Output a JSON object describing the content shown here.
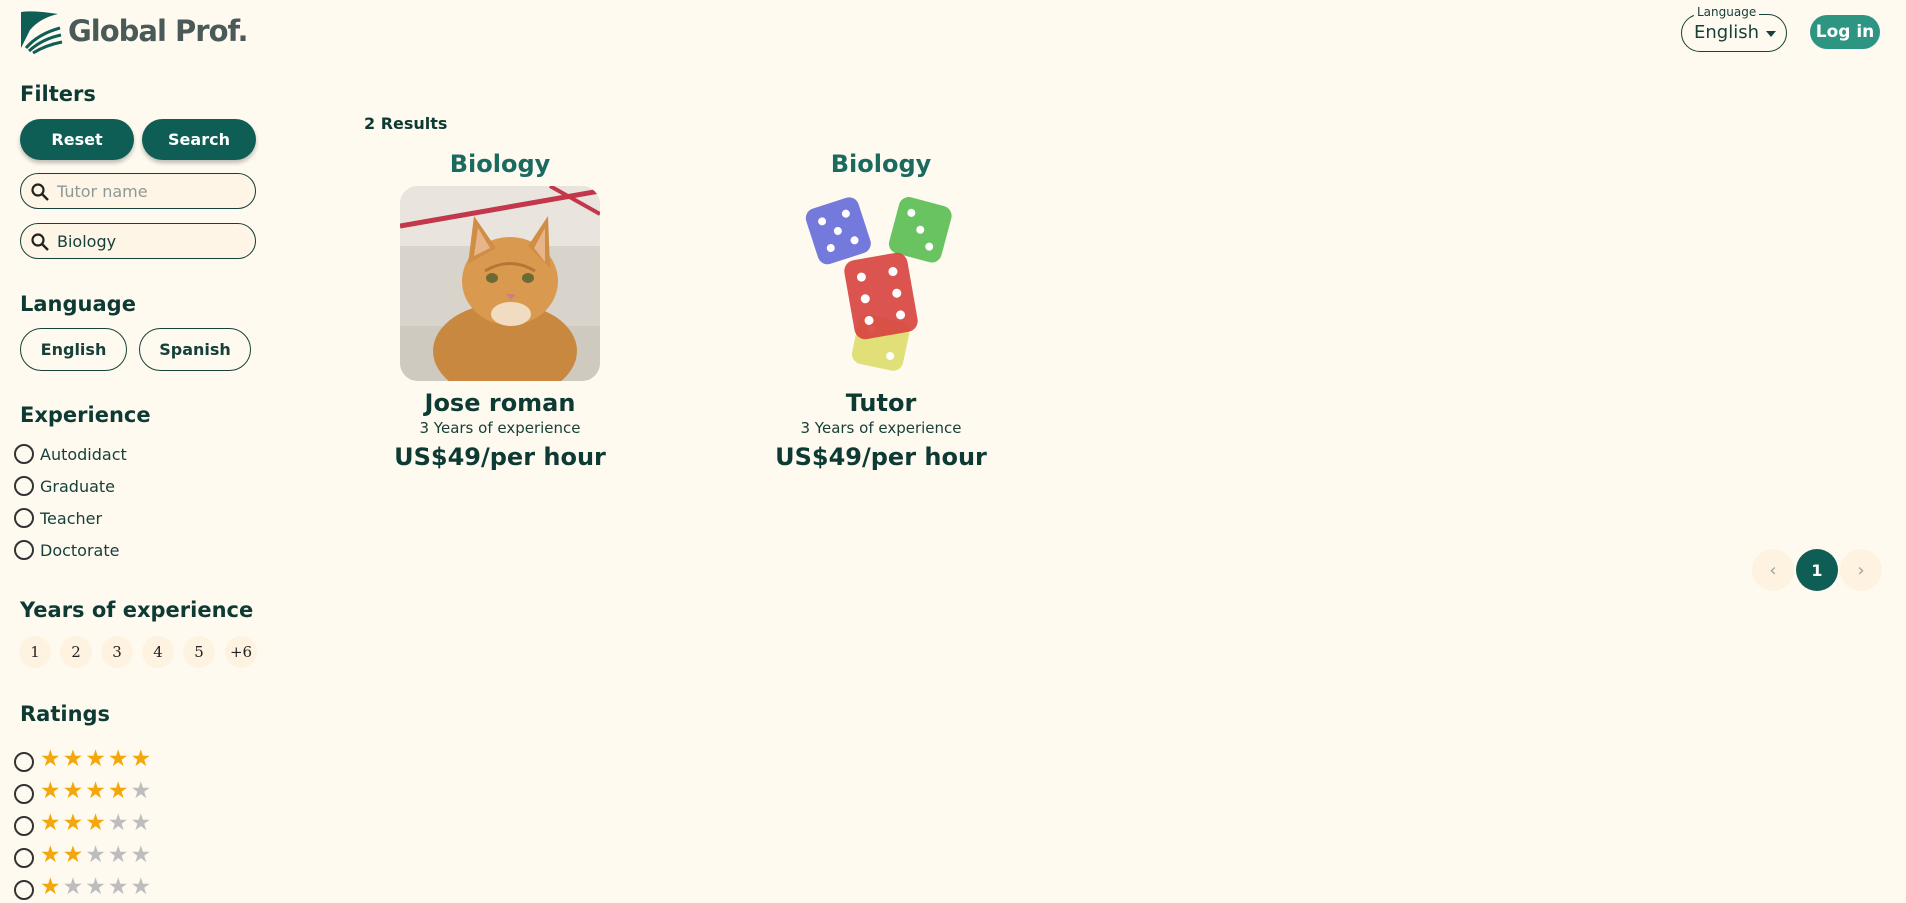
{
  "app": {
    "logo_text": "Global Prof."
  },
  "header": {
    "language_legend": "Language",
    "language_value": "English",
    "login_label": "Log in"
  },
  "sidebar": {
    "filters_title": "Filters",
    "reset_label": "Reset",
    "search_label": "Search",
    "tutor_name_placeholder": "Tutor name",
    "tutor_name_value": "",
    "subject_value": "Biology",
    "language_title": "Language",
    "languages": [
      "English",
      "Spanish"
    ],
    "experience_title": "Experience",
    "experience_options": [
      "Autodidact",
      "Graduate",
      "Teacher",
      "Doctorate"
    ],
    "years_title": "Years of experience",
    "years_options": [
      "1",
      "2",
      "3",
      "4",
      "5",
      "+6"
    ],
    "ratings_title": "Ratings",
    "ratings": [
      5,
      4,
      3,
      2,
      1
    ]
  },
  "main": {
    "results_label": "2 Results",
    "cards": [
      {
        "subject": "Biology",
        "name": "Jose roman",
        "experience": "3 Years of experience",
        "price": "US$49/per hour",
        "image": "cat-photo"
      },
      {
        "subject": "Biology",
        "name": "Tutor",
        "experience": "3 Years of experience",
        "price": "US$49/per hour",
        "image": "dice-photo"
      }
    ],
    "pagination": {
      "current_page": "1",
      "prev_icon": "chevron-left-icon",
      "next_icon": "chevron-right-icon"
    }
  },
  "colors": {
    "background": "#fffaf0",
    "primary": "#0f5e55",
    "accent": "#2e9583",
    "star": "#f4a70a"
  }
}
